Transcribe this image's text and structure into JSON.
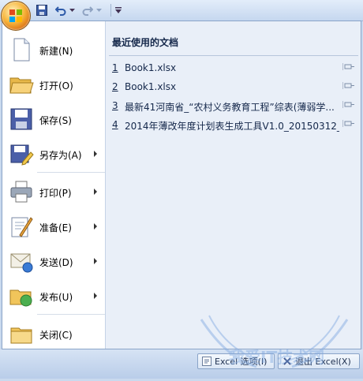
{
  "quick_access": {
    "save_icon": "save-icon",
    "undo_icon": "undo-icon",
    "redo_icon": "redo-icon",
    "customize_icon": "customize-toolbar-icon"
  },
  "menu": {
    "items": [
      {
        "label": "新建(N)",
        "icon": "new-document-icon",
        "has_submenu": false
      },
      {
        "label": "打开(O)",
        "icon": "open-folder-icon",
        "has_submenu": false
      },
      {
        "label": "保存(S)",
        "icon": "floppy-disk-icon",
        "has_submenu": false
      },
      {
        "label": "另存为(A)",
        "icon": "save-as-icon",
        "has_submenu": true
      },
      {
        "label": "打印(P)",
        "icon": "printer-icon",
        "has_submenu": true
      },
      {
        "label": "准备(E)",
        "icon": "prepare-icon",
        "has_submenu": true
      },
      {
        "label": "发送(D)",
        "icon": "send-icon",
        "has_submenu": true
      },
      {
        "label": "发布(U)",
        "icon": "publish-icon",
        "has_submenu": true
      },
      {
        "label": "关闭(C)",
        "icon": "close-folder-icon",
        "has_submenu": false
      }
    ]
  },
  "recent": {
    "title": "最近使用的文档",
    "items": [
      {
        "num": "1",
        "name": "Book1.xlsx"
      },
      {
        "num": "2",
        "name": "Book1.xlsx"
      },
      {
        "num": "3",
        "name": "最新41河南省_“农村义务教育工程”综表(薄弱学..."
      },
      {
        "num": "4",
        "name": "2014年薄改年度计划表生成工具V1.0_20150312_..."
      }
    ]
  },
  "bottom": {
    "options_label": "Excel 选项(I)",
    "exit_label": "退出 Excel(X)"
  },
  "watermark": {
    "text": "我爱IT技术网"
  },
  "colors": {
    "accent": "#f7b53b",
    "panel": "#e9eff8",
    "frame": "#c9d9ee"
  }
}
